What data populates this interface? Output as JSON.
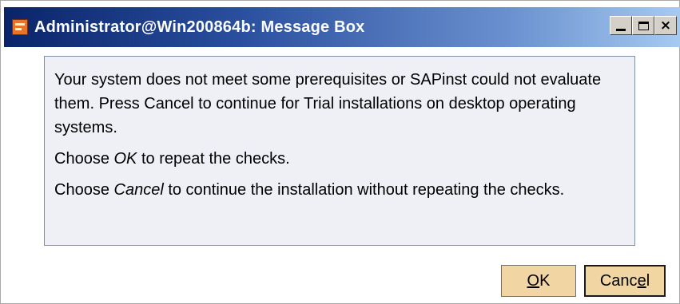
{
  "window": {
    "title": "Administrator@Win200864b: Message Box",
    "app_icon": "sapinst-icon",
    "caption_buttons": {
      "minimize": "minimize-icon",
      "maximize": "maximize-icon",
      "close": "×"
    }
  },
  "message": {
    "paragraph1": "Your system does not meet some prerequisites or SAPinst could not evaluate them. Press Cancel to continue for Trial installations on desktop operating systems.",
    "paragraph2": {
      "before": "Choose ",
      "emph": "OK",
      "after": " to repeat the checks."
    },
    "paragraph3": {
      "before": "Choose ",
      "emph": "Cancel",
      "after": " to continue the installation without repeating the checks."
    }
  },
  "buttons": {
    "ok": {
      "mnemonic": "O",
      "rest": "K"
    },
    "cancel": {
      "before": "Canc",
      "mnemonic": "e",
      "after": "l"
    }
  },
  "colors": {
    "title_gradient_start": "#0a246a",
    "title_gradient_end": "#a6caf0",
    "panel_bg": "#eef0f6",
    "button_bg": "#f1d5a3"
  }
}
